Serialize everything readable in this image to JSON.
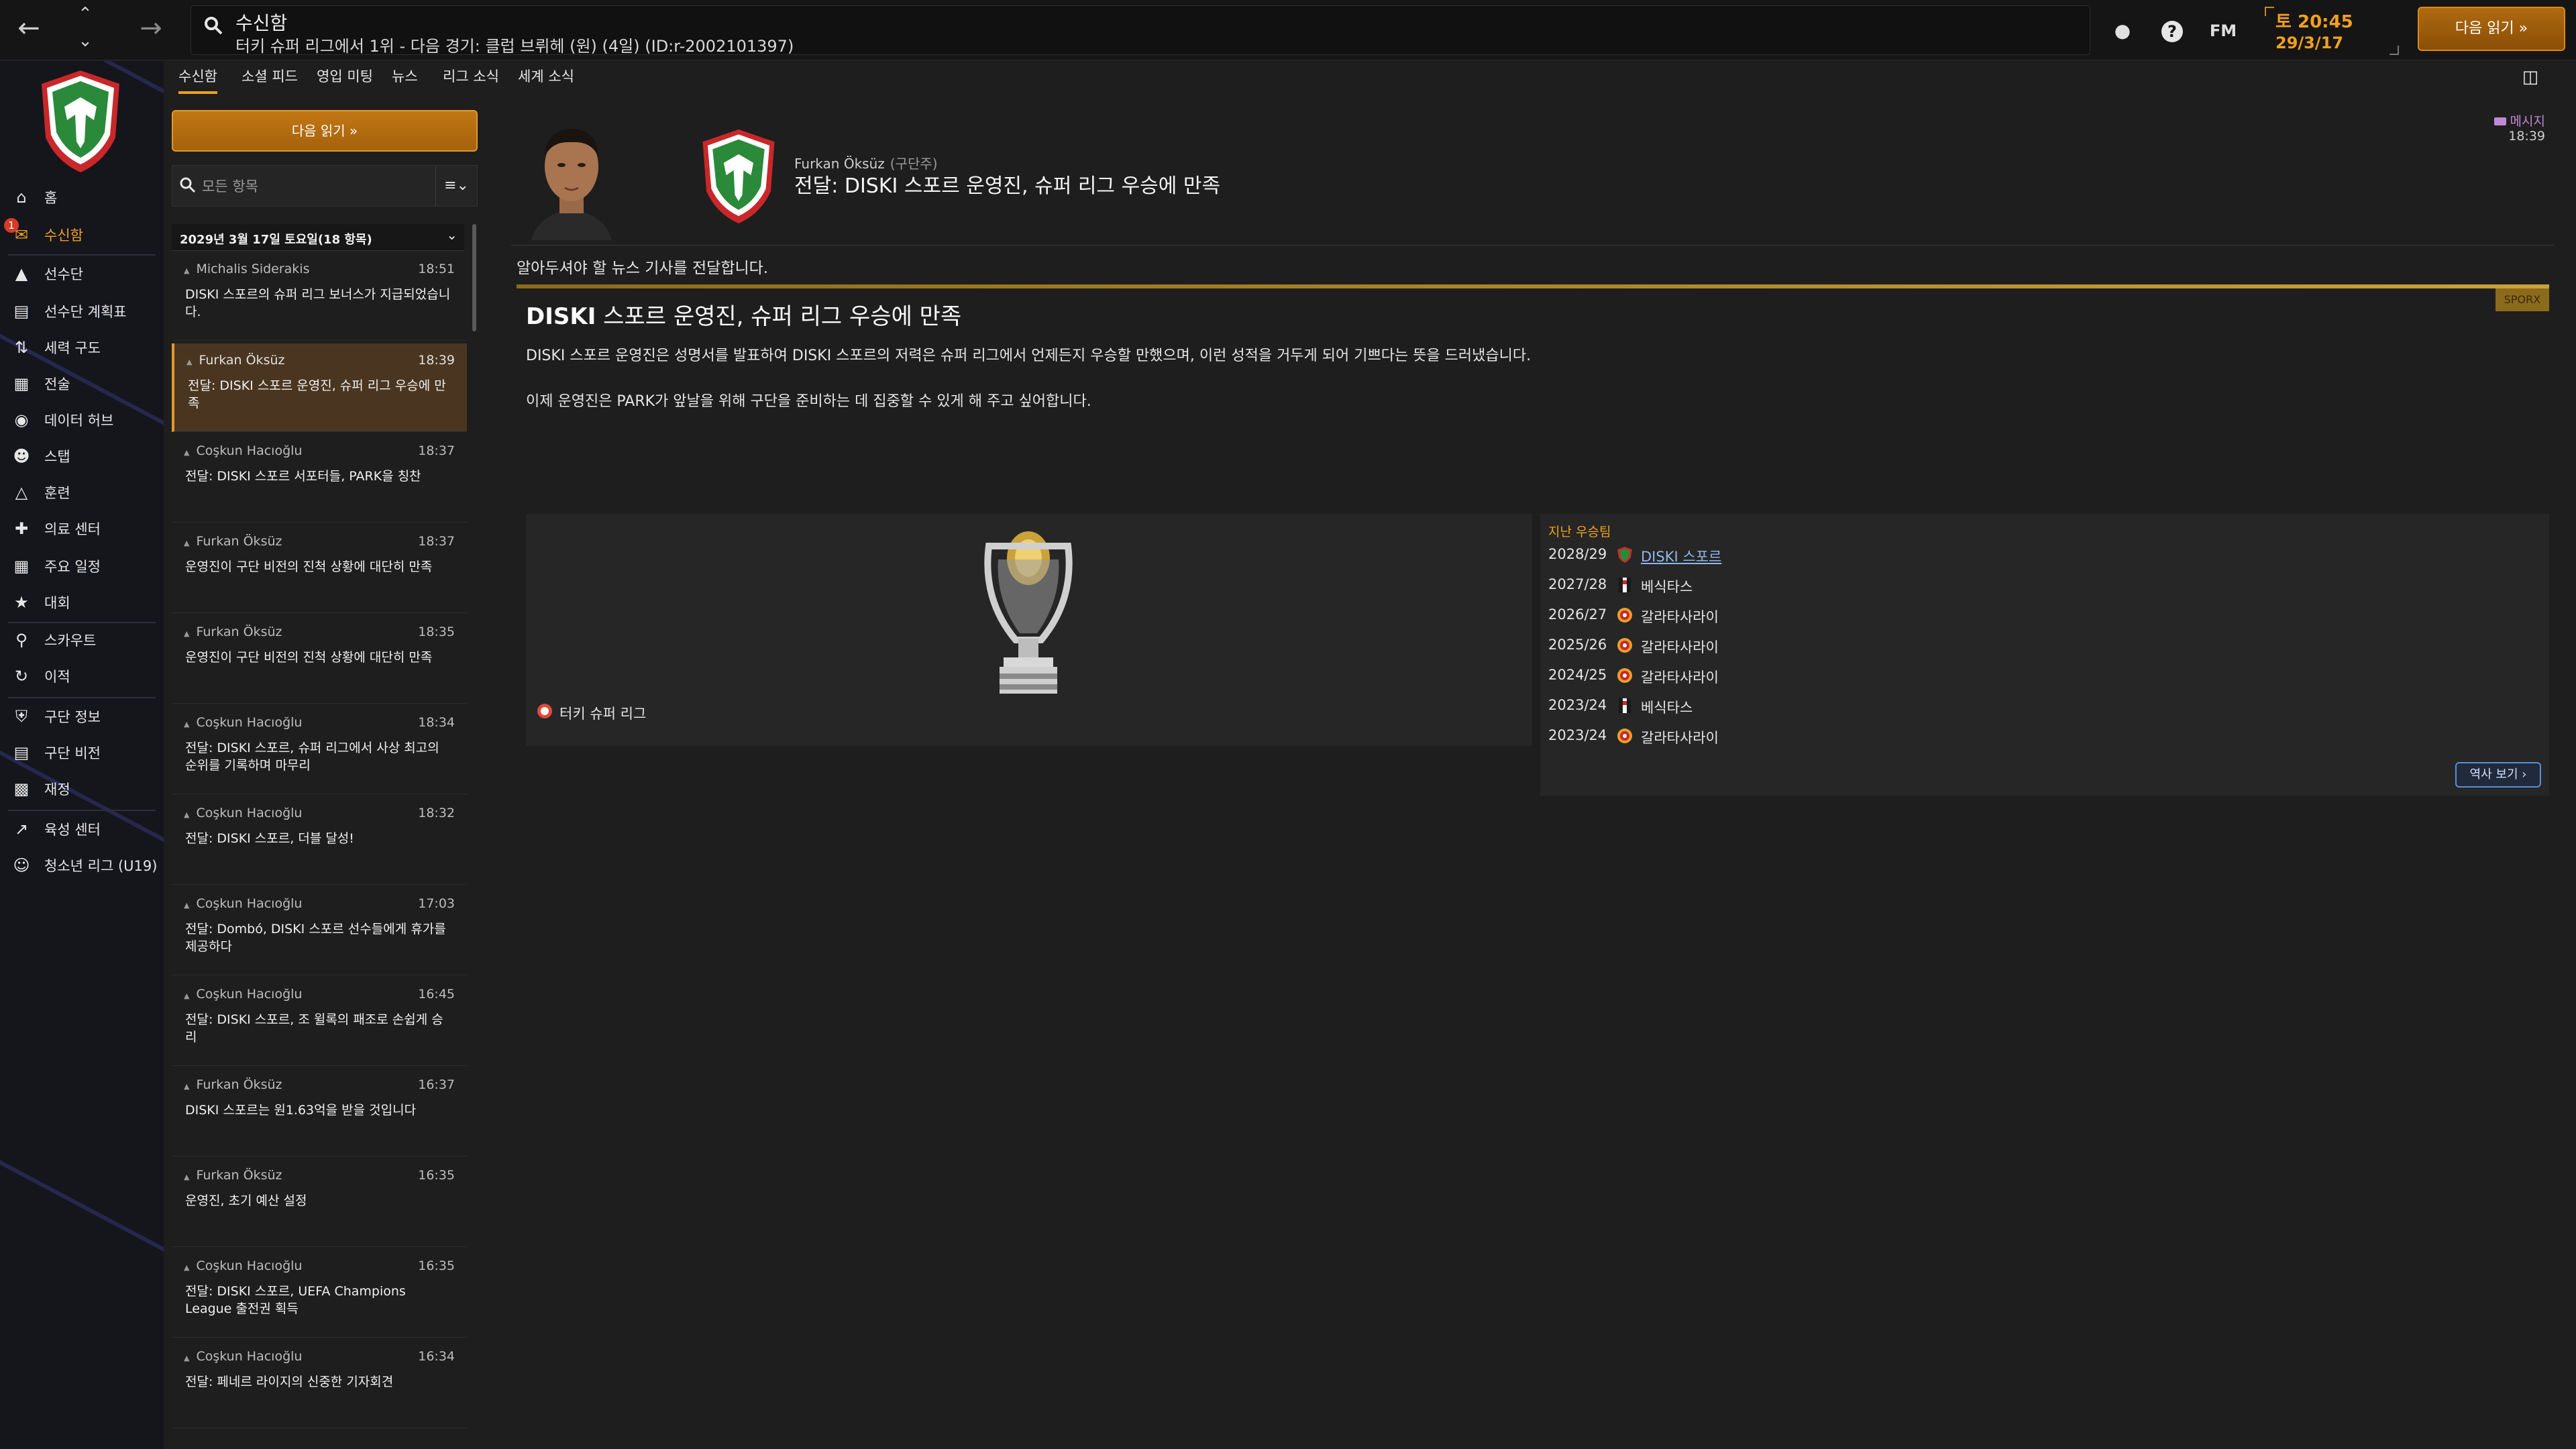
{
  "topbar": {
    "title": "수신함",
    "subtitle": "터키 슈퍼 리그에서 1위 - 다음 경기: 클럽 브뤼헤 (원) (4일) (ID:r-2002101397)",
    "time": "토 20:45",
    "date": "29/3/17",
    "continue_label": "다음 읽기",
    "fm_label": "FM",
    "icons": {
      "back": "arrow-left-icon",
      "forward": "arrow-right-icon",
      "search": "search-icon",
      "globe": "globe-icon",
      "help": "help-icon"
    }
  },
  "sidebar": {
    "badge": "1",
    "items": [
      {
        "label": "홈",
        "icon": "home-icon"
      },
      {
        "label": "수신함",
        "icon": "inbox-icon"
      },
      {
        "label": "선수단",
        "icon": "shirt-icon"
      },
      {
        "label": "선수단 계획표",
        "icon": "clipboard-icon"
      },
      {
        "label": "세력 구도",
        "icon": "dynamics-icon"
      },
      {
        "label": "전술",
        "icon": "tactics-icon"
      },
      {
        "label": "데이터 허브",
        "icon": "data-hub-icon"
      },
      {
        "label": "스탭",
        "icon": "staff-icon"
      },
      {
        "label": "훈련",
        "icon": "training-icon"
      },
      {
        "label": "의료 센터",
        "icon": "medical-icon"
      },
      {
        "label": "주요 일정",
        "icon": "calendar-icon"
      },
      {
        "label": "대회",
        "icon": "trophy-icon"
      },
      {
        "label": "스카우트",
        "icon": "scout-icon"
      },
      {
        "label": "이적",
        "icon": "transfer-icon"
      },
      {
        "label": "구단 정보",
        "icon": "club-info-icon"
      },
      {
        "label": "구단 비전",
        "icon": "vision-icon"
      },
      {
        "label": "재정",
        "icon": "finance-icon"
      },
      {
        "label": "육성 센터",
        "icon": "development-icon"
      },
      {
        "label": "청소년 리그 (U19)",
        "icon": "youth-icon"
      }
    ]
  },
  "subtabs": [
    "수신함",
    "소셜 피드",
    "영입 미팅",
    "뉴스",
    "리그 소식",
    "세계 소식"
  ],
  "inbox": {
    "continue_label": "다음 읽기",
    "filter_placeholder": "모든 항목",
    "sort_label": "≡⌄",
    "date_group": "2029년 3월 17일 토요일(18 항목)",
    "messages": [
      {
        "sender": "Michalis Siderakis",
        "time": "18:51",
        "subject": "DISKI 스포르의 슈퍼 리그 보너스가 지급되었습니다."
      },
      {
        "sender": "Furkan Öksüz",
        "time": "18:39",
        "subject": "전달: DISKI 스포르 운영진, 슈퍼 리그 우승에 만족"
      },
      {
        "sender": "Coşkun Hacıoğlu",
        "time": "18:37",
        "subject": "전달: DISKI 스포르 서포터들, PARK을 칭찬"
      },
      {
        "sender": "Furkan Öksüz",
        "time": "18:37",
        "subject": "운영진이 구단 비전의 진척 상황에 대단히 만족"
      },
      {
        "sender": "Furkan Öksüz",
        "time": "18:35",
        "subject": "운영진이 구단 비전의 진척 상황에 대단히 만족"
      },
      {
        "sender": "Coşkun Hacıoğlu",
        "time": "18:34",
        "subject": "전달: DISKI 스포르, 슈퍼 리그에서 사상 최고의 순위를 기록하며 마무리"
      },
      {
        "sender": "Coşkun Hacıoğlu",
        "time": "18:32",
        "subject": "전달: DISKI 스포르, 더블 달성!"
      },
      {
        "sender": "Coşkun Hacıoğlu",
        "time": "17:03",
        "subject": "전달: Dombó, DISKI 스포르 선수들에게 휴가를 제공하다"
      },
      {
        "sender": "Coşkun Hacıoğlu",
        "time": "16:45",
        "subject": "전달: DISKI 스포르, 조 윌록의 패조로 손쉽게 승리"
      },
      {
        "sender": "Furkan Öksüz",
        "time": "16:37",
        "subject": "DISKI 스포르는 원1.63억을 받을 것입니다"
      },
      {
        "sender": "Furkan Öksüz",
        "time": "16:35",
        "subject": "운영진, 초기 예산 설정"
      },
      {
        "sender": "Coşkun Hacıoğlu",
        "time": "16:35",
        "subject": "전달: DISKI 스포르, UEFA Champions League 출전권 획득"
      },
      {
        "sender": "Coşkun Hacıoğlu",
        "time": "16:34",
        "subject": "전달: 페네르 라이지의 신중한 기자회견"
      }
    ]
  },
  "detail": {
    "from_name": "Furkan Öksüz",
    "from_role": "(구단주)",
    "headline": "전달: DISKI 스포르 운영진, 슈퍼 리그 우승에 만족",
    "tag": "메시지",
    "time": "18:39",
    "intro": "알아두셔야 할 뉴스 기사를 전달합니다.",
    "article": {
      "badge": "SPORX",
      "title_bold": "DISKI",
      "title_rest": " 스포르 운영진, 슈퍼 리그 우승에 만족",
      "para1": "DISKI 스포르 운영진은 성명서를 발표하여 DISKI 스포르의 저력은 슈퍼 리그에서 언제든지 우승할 만했으며, 이런 성적을 거두게 되어 기쁘다는 뜻을 드러냈습니다.",
      "para2": "이제 운영진은 PARK가 앞날을 위해 구단을 준비하는 데 집중할 수 있게 해 주고 싶어합니다.",
      "competition": "터키 슈퍼 리그",
      "winners_title": "지난 우승팀",
      "winners": [
        {
          "season": "2028/29",
          "club": "DISKI 스포르",
          "crest": "diski-crest-icon"
        },
        {
          "season": "2027/28",
          "club": "베식타스",
          "crest": "besiktas-crest-icon"
        },
        {
          "season": "2026/27",
          "club": "갈라타사라이",
          "crest": "galatasaray-crest-icon"
        },
        {
          "season": "2025/26",
          "club": "갈라타사라이",
          "crest": "galatasaray-crest-icon"
        },
        {
          "season": "2024/25",
          "club": "갈라타사라이",
          "crest": "galatasaray-crest-icon"
        },
        {
          "season": "2023/24",
          "club": "베식타스",
          "crest": "besiktas-crest-icon"
        },
        {
          "season": "2023/24",
          "club": "갈라타사라이",
          "crest": "galatasaray-crest-icon"
        }
      ],
      "history_label": "역사 보기 ›"
    }
  },
  "colors": {
    "accent": "#f0a020",
    "link": "#8fb7ea",
    "selected_bg": "#4a3620",
    "crest_green": "#2a8a3a",
    "crest_red": "#c8282a"
  }
}
